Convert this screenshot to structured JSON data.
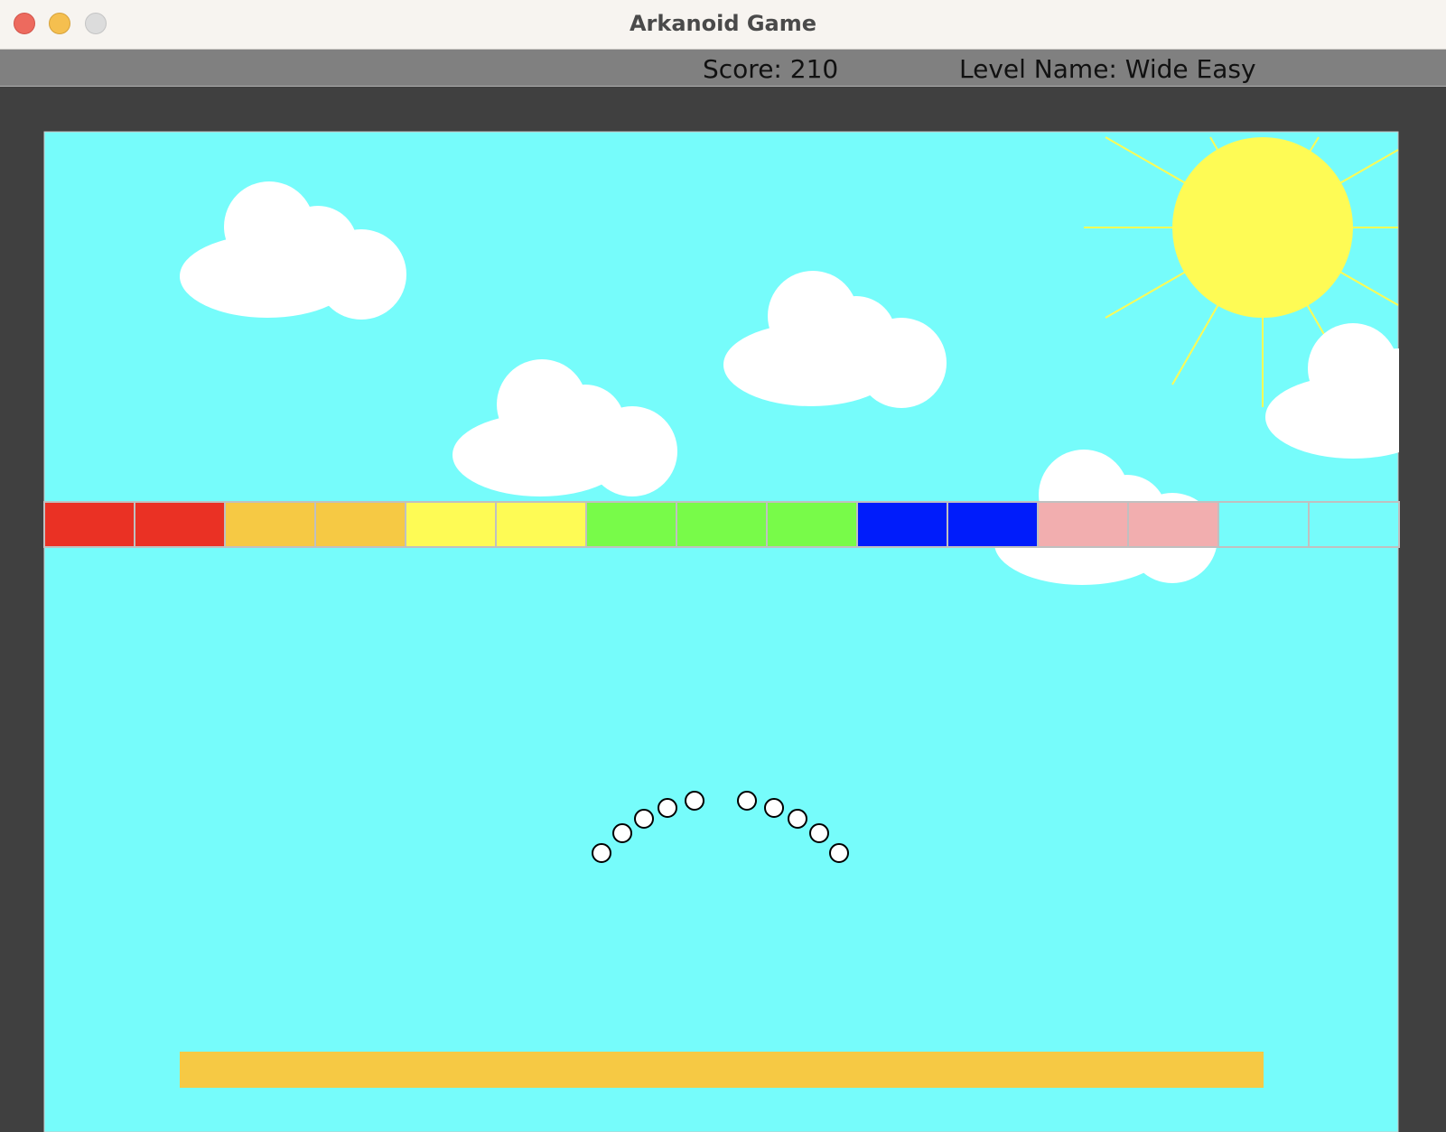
{
  "window": {
    "title": "Arkanoid Game"
  },
  "hud": {
    "score_text": "Score: 210",
    "level_text": "Level Name: Wide Easy"
  },
  "colors": {
    "sky": "#76fcfb",
    "border": "#404040",
    "sun": "#fefb55",
    "cloud": "#ffffff",
    "paddle": "#f6c944",
    "ball_fill": "#ffffff",
    "ball_stroke": "#000000"
  },
  "blocks": [
    {
      "color": "#ea3124"
    },
    {
      "color": "#ea3124"
    },
    {
      "color": "#f6c944"
    },
    {
      "color": "#f6c944"
    },
    {
      "color": "#fefb55"
    },
    {
      "color": "#fefb55"
    },
    {
      "color": "#78fb49"
    },
    {
      "color": "#78fb49"
    },
    {
      "color": "#78fb49"
    },
    {
      "color": "#001cfb"
    },
    {
      "color": "#001cfb"
    },
    {
      "color": "#f2aeaf"
    },
    {
      "color": "#f2aeaf"
    },
    {
      "color": "#76fcfb"
    },
    {
      "color": "#76fcfb"
    }
  ],
  "balls_count": 10
}
